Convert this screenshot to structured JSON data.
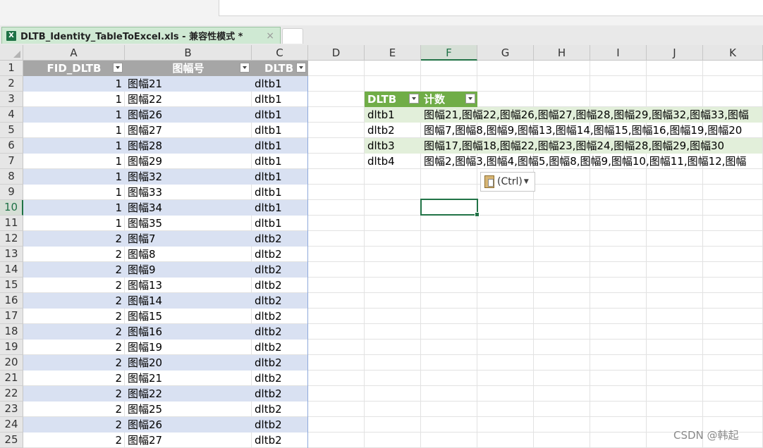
{
  "tab": {
    "title": "DLTB_Identity_TableToExcel.xls  -  兼容性模式 *",
    "close": "×",
    "icon": "X"
  },
  "columns": [
    "A",
    "B",
    "C",
    "D",
    "E",
    "F",
    "G",
    "H",
    "I",
    "J",
    "K"
  ],
  "rows": [
    "1",
    "2",
    "3",
    "4",
    "5",
    "6",
    "7",
    "8",
    "9",
    "10",
    "11",
    "12",
    "13",
    "14",
    "15",
    "16",
    "17",
    "18",
    "19",
    "20",
    "21",
    "22",
    "23",
    "24",
    "25"
  ],
  "table": {
    "headers": [
      "FID_DLTB",
      "图幅号",
      "DLTB"
    ],
    "data": [
      [
        "1",
        "图幅21",
        "dltb1"
      ],
      [
        "1",
        "图幅22",
        "dltb1"
      ],
      [
        "1",
        "图幅26",
        "dltb1"
      ],
      [
        "1",
        "图幅27",
        "dltb1"
      ],
      [
        "1",
        "图幅28",
        "dltb1"
      ],
      [
        "1",
        "图幅29",
        "dltb1"
      ],
      [
        "1",
        "图幅32",
        "dltb1"
      ],
      [
        "1",
        "图幅33",
        "dltb1"
      ],
      [
        "1",
        "图幅34",
        "dltb1"
      ],
      [
        "1",
        "图幅35",
        "dltb1"
      ],
      [
        "2",
        "图幅7",
        "dltb2"
      ],
      [
        "2",
        "图幅8",
        "dltb2"
      ],
      [
        "2",
        "图幅9",
        "dltb2"
      ],
      [
        "2",
        "图幅13",
        "dltb2"
      ],
      [
        "2",
        "图幅14",
        "dltb2"
      ],
      [
        "2",
        "图幅15",
        "dltb2"
      ],
      [
        "2",
        "图幅16",
        "dltb2"
      ],
      [
        "2",
        "图幅19",
        "dltb2"
      ],
      [
        "2",
        "图幅20",
        "dltb2"
      ],
      [
        "2",
        "图幅21",
        "dltb2"
      ],
      [
        "2",
        "图幅22",
        "dltb2"
      ],
      [
        "2",
        "图幅25",
        "dltb2"
      ],
      [
        "2",
        "图幅26",
        "dltb2"
      ],
      [
        "2",
        "图幅27",
        "dltb2"
      ]
    ]
  },
  "pivot": {
    "headers": [
      "DLTB",
      "计数"
    ],
    "data": [
      [
        "dltb1",
        "图幅21,图幅22,图幅26,图幅27,图幅28,图幅29,图幅32,图幅33,图幅"
      ],
      [
        "dltb2",
        "图幅7,图幅8,图幅9,图幅13,图幅14,图幅15,图幅16,图幅19,图幅20"
      ],
      [
        "dltb3",
        "图幅17,图幅18,图幅22,图幅23,图幅24,图幅28,图幅29,图幅30"
      ],
      [
        "dltb4",
        "图幅2,图幅3,图幅4,图幅5,图幅8,图幅9,图幅10,图幅11,图幅12,图幅"
      ]
    ]
  },
  "paste_options": {
    "label": "(Ctrl)"
  },
  "watermark": "CSDN @韩起",
  "colors": {
    "header_band": "#d9e1f2",
    "pivot_header": "#70ad47",
    "pivot_band": "#e2efda",
    "accent": "#217346"
  }
}
